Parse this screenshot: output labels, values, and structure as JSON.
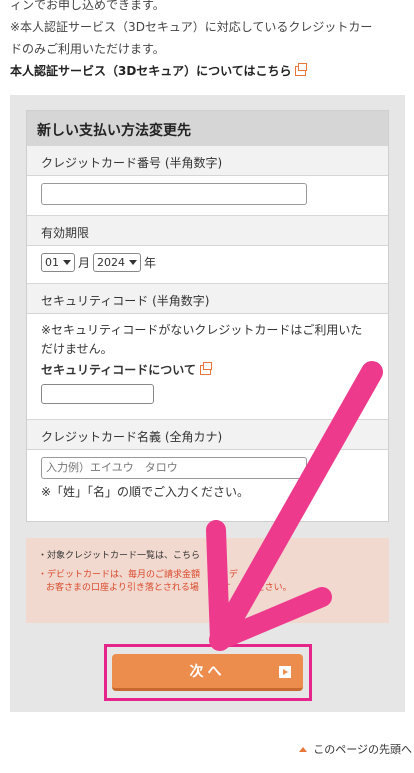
{
  "intro": {
    "line0": "ィンでお申し込めできます。",
    "line1": "※本人認証サービス（3Dセキュア）に対応しているクレジットカー",
    "line2": "ドのみご利用いただけます。",
    "link": "本人認証サービス（3Dセキュア）についてはこちら"
  },
  "form": {
    "title": "新しい支払い方法変更先",
    "card_number_label": "クレジットカード番号 (半角数字)",
    "expiry_label": "有効期限",
    "month_value": "01",
    "month_unit": "月",
    "year_value": "2024",
    "year_unit": "年",
    "security_label": "セキュリティコード (半角数字)",
    "security_note": "※セキュリティコードがないクレジットカードはご利用いただけません。",
    "security_link": "セキュリティコードについて",
    "holder_label": "クレジットカード名義 (全角カナ)",
    "holder_placeholder": "入力例）エイユウ　タロウ",
    "holder_note": "※「姓」「名」の順でご入力ください。"
  },
  "notice": {
    "line1": "・対象クレジットカード一覧は、こちら",
    "line2": "・デビットカードは、毎月のご請求金額",
    "line3": "お客さまの口座より引き落とされる場",
    "line2_tail": "デ",
    "line3_tail": "す",
    "line3_end": "ださい。"
  },
  "next_button": {
    "label": "次へ"
  },
  "page_top": {
    "label": "このページの先頭へ"
  },
  "colors": {
    "accent": "#ec8d4e",
    "highlight": "#e6258a",
    "arrow": "#ee3a8c"
  },
  "icons": [
    "external-link-icon",
    "chevron-down-icon",
    "arrow-right-icon",
    "triangle-up-icon"
  ]
}
